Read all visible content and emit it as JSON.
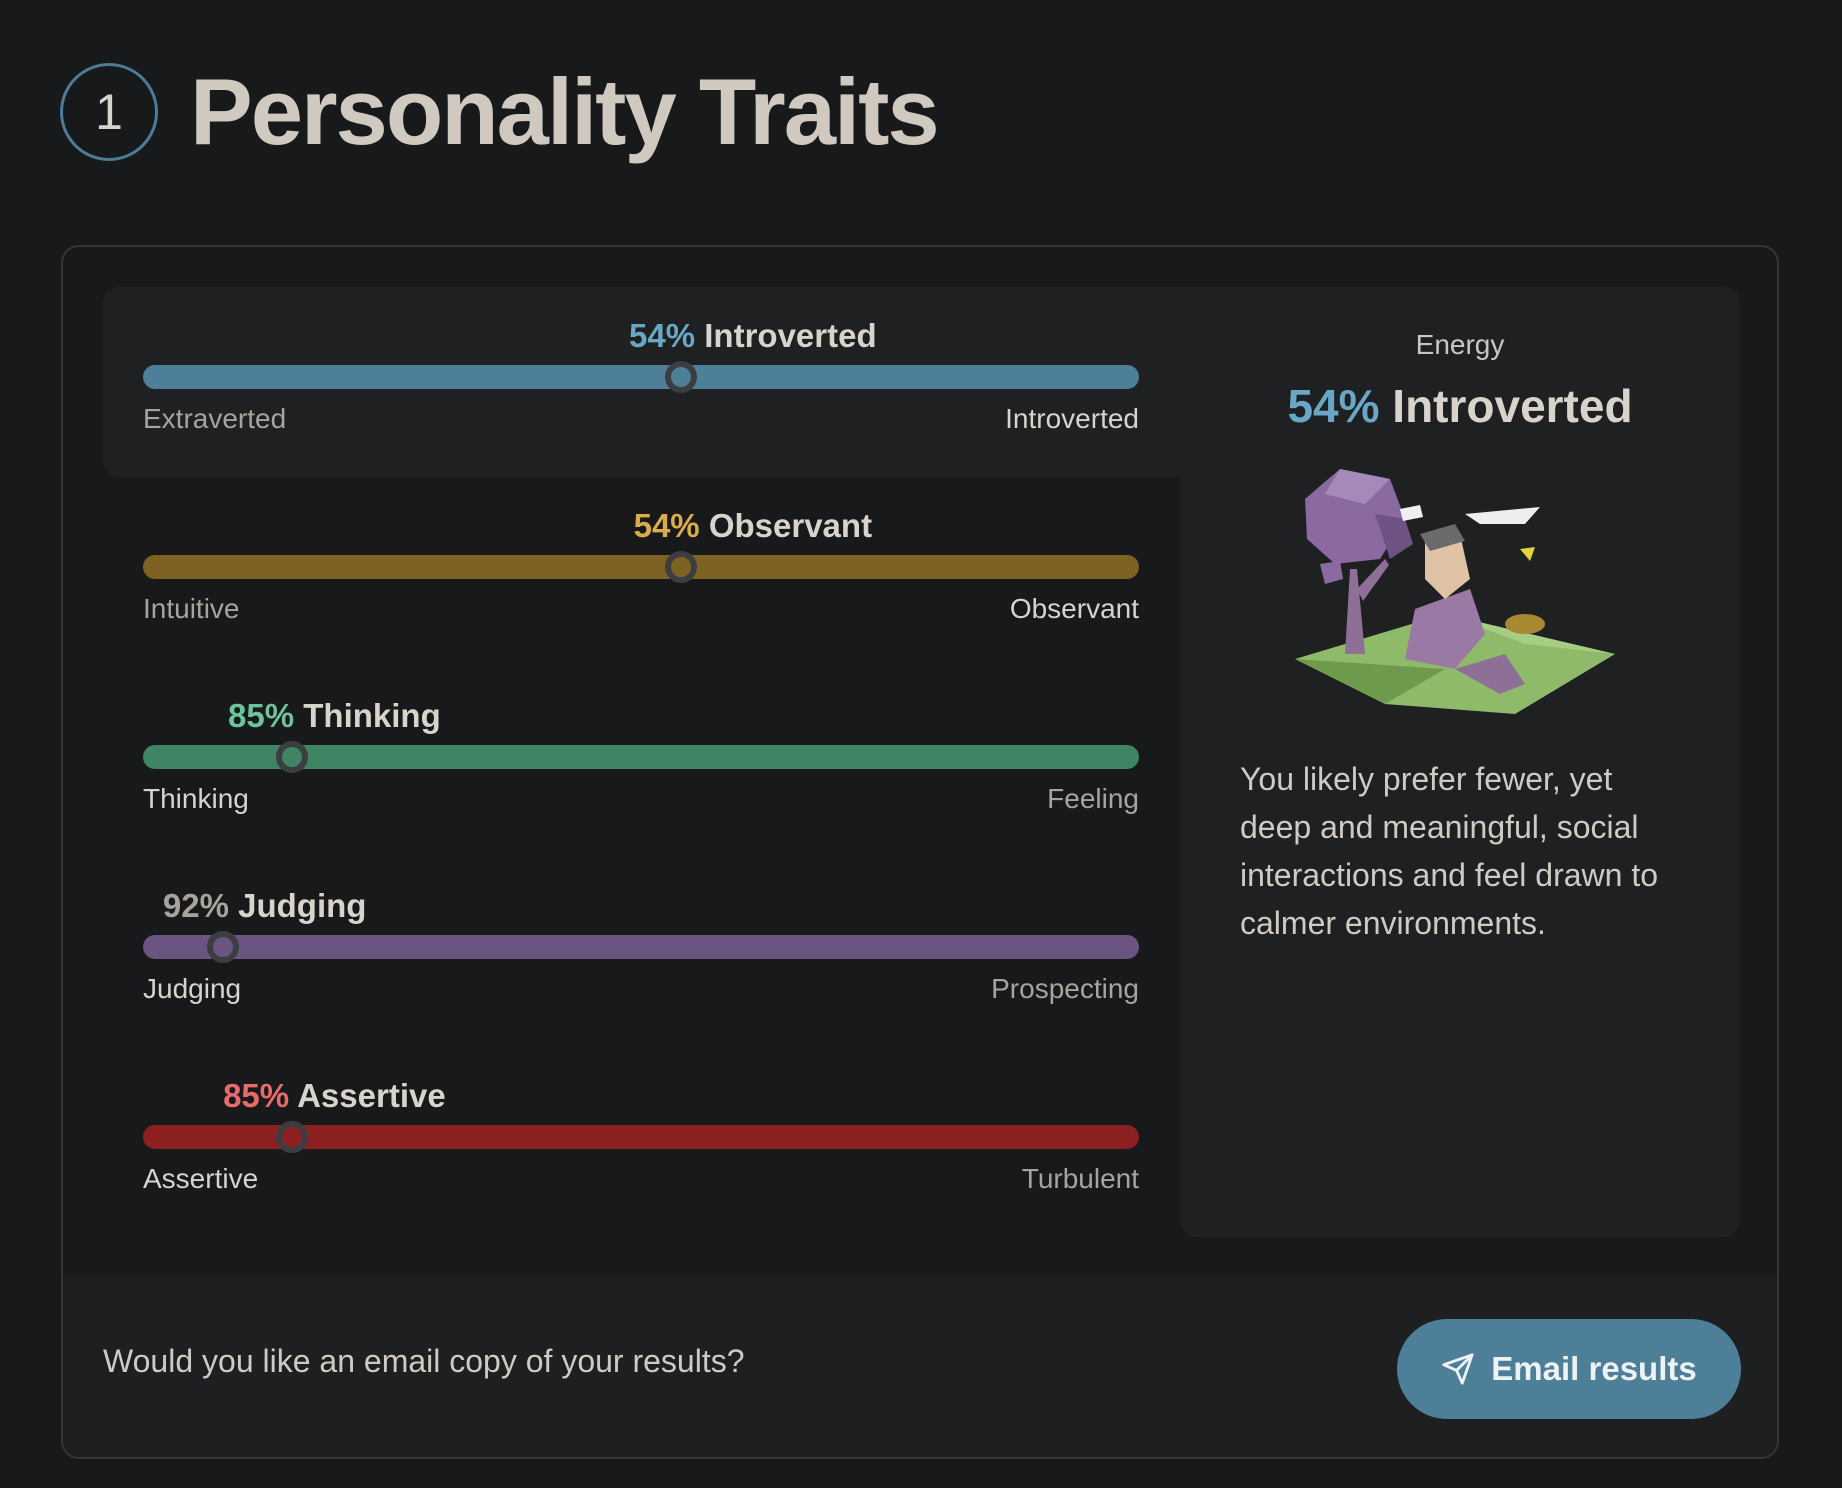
{
  "header": {
    "step_number": "1",
    "title": "Personality Traits"
  },
  "traits": [
    {
      "percent": "54%",
      "name": "Introverted",
      "left": "Extraverted",
      "right": "Introverted",
      "position": 0.54,
      "side": "right",
      "bar_color": "#4e7f99",
      "pct_color": "#6aa7c6",
      "knob_fill": "#4e7f99",
      "left_color": "#a8a39b",
      "right_color": "#d8d3cb"
    },
    {
      "percent": "54%",
      "name": "Observant",
      "left": "Intuitive",
      "right": "Observant",
      "position": 0.54,
      "side": "right",
      "bar_color": "#7e6222",
      "pct_color": "#d9ae4a",
      "knob_fill": "#7e6222",
      "left_color": "#a8a39b",
      "right_color": "#d8d3cb"
    },
    {
      "percent": "85%",
      "name": "Thinking",
      "left": "Thinking",
      "right": "Feeling",
      "position": 0.85,
      "side": "left",
      "bar_color": "#3f8463",
      "pct_color": "#6ec49a",
      "knob_fill": "#3f8463",
      "left_color": "#d8d3cb",
      "right_color": "#a8a39b"
    },
    {
      "percent": "92%",
      "name": "Judging",
      "left": "Judging",
      "right": "Prospecting",
      "position": 0.92,
      "side": "left",
      "bar_color": "#6a5482",
      "pct_color": "#a8a39b",
      "knob_fill": "#6a5482",
      "left_color": "#d8d3cb",
      "right_color": "#a8a39b"
    },
    {
      "percent": "85%",
      "name": "Assertive",
      "left": "Assertive",
      "right": "Turbulent",
      "position": 0.85,
      "side": "left",
      "bar_color": "#8c2020",
      "pct_color": "#e86a6a",
      "knob_fill": "#8c2020",
      "left_color": "#d8d3cb",
      "right_color": "#a8a39b"
    }
  ],
  "side_panel": {
    "label": "Energy",
    "percent": "54%",
    "trait": "Introverted",
    "description": "You likely prefer fewer, yet deep and meaningful, social interactions and feel drawn to calmer environments.",
    "illustration": "introvert-reading-under-tree"
  },
  "footer": {
    "question": "Would you like an email copy of your results?",
    "button_label": "Email results",
    "button_icon": "paper-plane-icon"
  }
}
